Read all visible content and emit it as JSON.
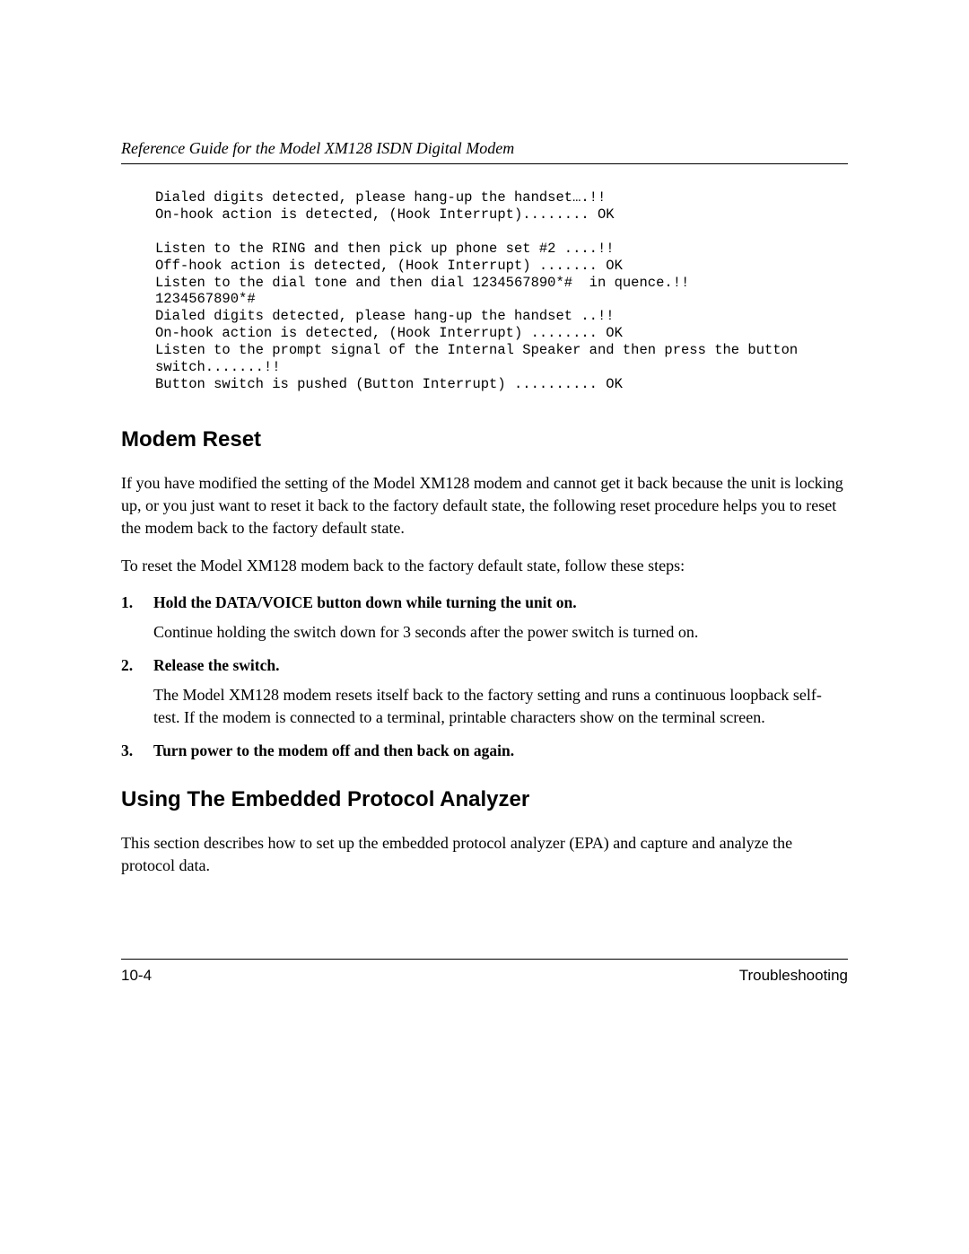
{
  "header": {
    "title": "Reference Guide for the Model XM128 ISDN Digital Modem"
  },
  "terminal": "Dialed digits detected, please hang-up the handset….!!\nOn-hook action is detected, (Hook Interrupt)........ OK\n\nListen to the RING and then pick up phone set #2 ....!!\nOff-hook action is detected, (Hook Interrupt) ....... OK\nListen to the dial tone and then dial 1234567890*#  in quence.!!\n1234567890*#\nDialed digits detected, please hang-up the handset ..!!\nOn-hook action is detected, (Hook Interrupt) ........ OK\nListen to the prompt signal of the Internal Speaker and then press the button\nswitch.......!!\nButton switch is pushed (Button Interrupt) .......... OK",
  "section1": {
    "heading": "Modem Reset",
    "para1": "If you have modified the setting of the Model XM128 modem and cannot get it back because the unit is locking up, or you just want to reset it back to the factory default state, the following reset procedure helps you to reset the modem back to the factory default state.",
    "para2": "To reset the Model XM128 modem back to the factory default state, follow these steps:",
    "steps": [
      {
        "bold": "Hold the DATA/VOICE button down while turning the unit on.",
        "detail": "Continue holding the switch down for 3 seconds after the power switch is turned on."
      },
      {
        "bold": "Release the switch.",
        "detail": "The Model XM128 modem resets itself back to the factory setting and runs a continuous loopback self-test. If the modem is connected to a terminal, printable characters show on the terminal screen."
      },
      {
        "bold": "Turn power to the modem off and then back on again.",
        "detail": ""
      }
    ]
  },
  "section2": {
    "heading": "Using The Embedded Protocol Analyzer",
    "para1": "This section describes how to set up the embedded protocol analyzer (EPA) and capture and analyze the protocol data."
  },
  "footer": {
    "page": "10-4",
    "section": "Troubleshooting"
  }
}
